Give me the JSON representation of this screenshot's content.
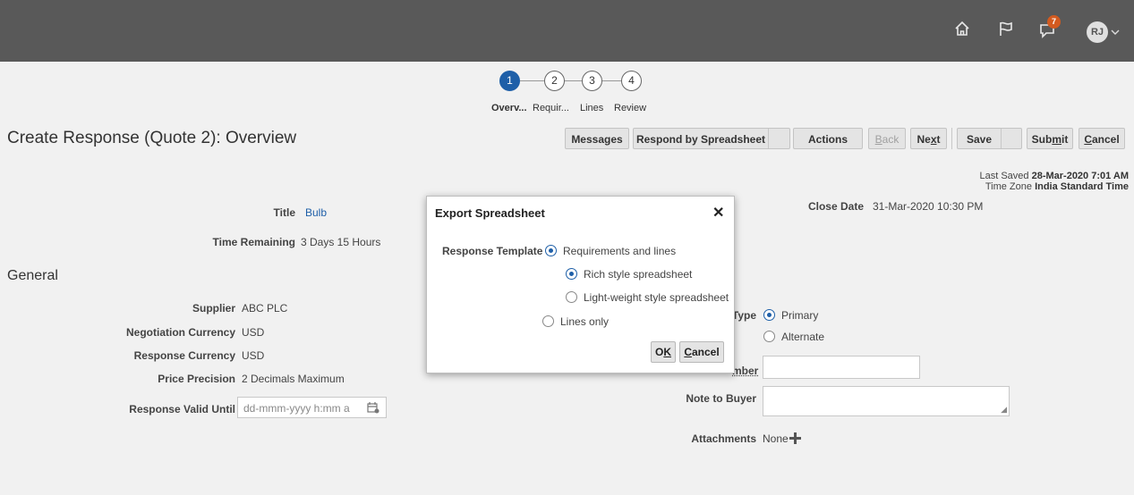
{
  "header": {
    "home_icon": "home-icon",
    "flag_icon": "flag-icon",
    "notifications_icon": "bell-icon",
    "notifications_count": "7",
    "avatar_initials": "RJ"
  },
  "train": {
    "steps": [
      {
        "number": "1",
        "label": "Overv..."
      },
      {
        "number": "2",
        "label": "Requir..."
      },
      {
        "number": "3",
        "label": "Lines"
      },
      {
        "number": "4",
        "label": "Review"
      }
    ]
  },
  "page_title": "Create Response (Quote 2): Overview",
  "toolbar": {
    "messages": "Messages",
    "respond_by_spreadsheet": "Respond by Spreadsheet",
    "actions": "Actions",
    "back_pre": "",
    "back_u": "B",
    "back_post": "ack",
    "next_pre": "Ne",
    "next_u": "x",
    "next_post": "t",
    "save": "Save",
    "submit_pre": "Sub",
    "submit_u": "m",
    "submit_post": "it",
    "cancel_pre": "",
    "cancel_u": "C",
    "cancel_post": "ancel"
  },
  "last_saved": {
    "label": "Last Saved",
    "value": "28-Mar-2020 7:01 AM",
    "tz_label": "Time Zone",
    "tz_value": "India Standard Time"
  },
  "header_fields": {
    "title_label": "Title",
    "title_value": "Bulb",
    "time_remaining_label": "Time Remaining",
    "time_remaining_value": "3 Days 15 Hours",
    "close_date_label": "Close Date",
    "close_date_value": "31-Mar-2020 10:30 PM"
  },
  "general": {
    "heading": "General",
    "supplier_label": "Supplier",
    "supplier_value": "ABC PLC",
    "neg_currency_label": "Negotiation Currency",
    "neg_currency_value": "USD",
    "resp_currency_label": "Response Currency",
    "resp_currency_value": "USD",
    "price_precision_label": "Price Precision",
    "price_precision_value": "2 Decimals Maximum",
    "valid_until_label": "Response Valid Until",
    "valid_until_placeholder": "dd-mmm-yyyy h:mm a",
    "type_label": "Type",
    "type_primary": "Primary",
    "type_alternate": "Alternate",
    "number_label_partial": "mber",
    "note_label": "Note to Buyer",
    "attachments_label": "Attachments",
    "attachments_value": "None"
  },
  "dialog": {
    "title": "Export Spreadsheet",
    "close": "✕",
    "template_label": "Response Template",
    "opt_req_lines": "Requirements and lines",
    "opt_rich": "Rich style spreadsheet",
    "opt_light": "Light-weight style spreadsheet",
    "opt_lines_only": "Lines only",
    "ok_pre": "O",
    "ok_u": "K",
    "cancel_pre": "",
    "cancel_u": "C",
    "cancel_post": "ancel"
  }
}
